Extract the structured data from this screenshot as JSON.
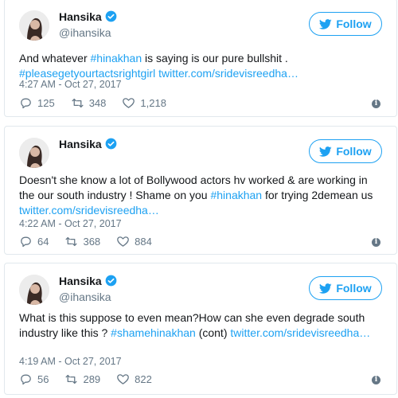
{
  "colors": {
    "accent": "#1da1f2",
    "muted": "#657786",
    "text": "#14171a",
    "border": "#e1e8ed"
  },
  "icons": [
    "verified-badge-icon",
    "twitter-bird-icon",
    "reply-icon",
    "retweet-icon",
    "like-icon",
    "info-icon"
  ],
  "tweets": [
    {
      "name": "Hansika",
      "handle": "@ihansika",
      "follow_label": "Follow",
      "text_parts": [
        "And whatever ",
        "#hinakhan",
        " is saying is our pure bullshit . ",
        "#pleasegetyourtactsrightgirl",
        " ",
        "twitter.com/sridevisreedha…"
      ],
      "time": "4:27 AM - Oct 27, 2017",
      "replies": "125",
      "retweets": "348",
      "likes": "1,218"
    },
    {
      "name": "Hansika",
      "handle": "",
      "follow_label": "Follow",
      "text_parts": [
        "Doesn't she know a lot of Bollywood actors hv worked & are working in the our south industry ! Shame on you ",
        "#hinakhan",
        " for trying 2demean us ",
        "twitter.com/sridevisreedha…",
        ""
      ],
      "time": "4:22 AM - Oct 27, 2017",
      "replies": "64",
      "retweets": "368",
      "likes": "884"
    },
    {
      "name": "Hansika",
      "handle": "@ihansika",
      "follow_label": "Follow",
      "text_parts": [
        "What is this suppose to even mean?How can she even degrade south industry like this ? ",
        "#shamehinakhan",
        " (cont) ",
        "twitter.com/sridevisreedha…",
        ""
      ],
      "time": "4:19 AM - Oct 27, 2017",
      "replies": "56",
      "retweets": "289",
      "likes": "822"
    }
  ]
}
